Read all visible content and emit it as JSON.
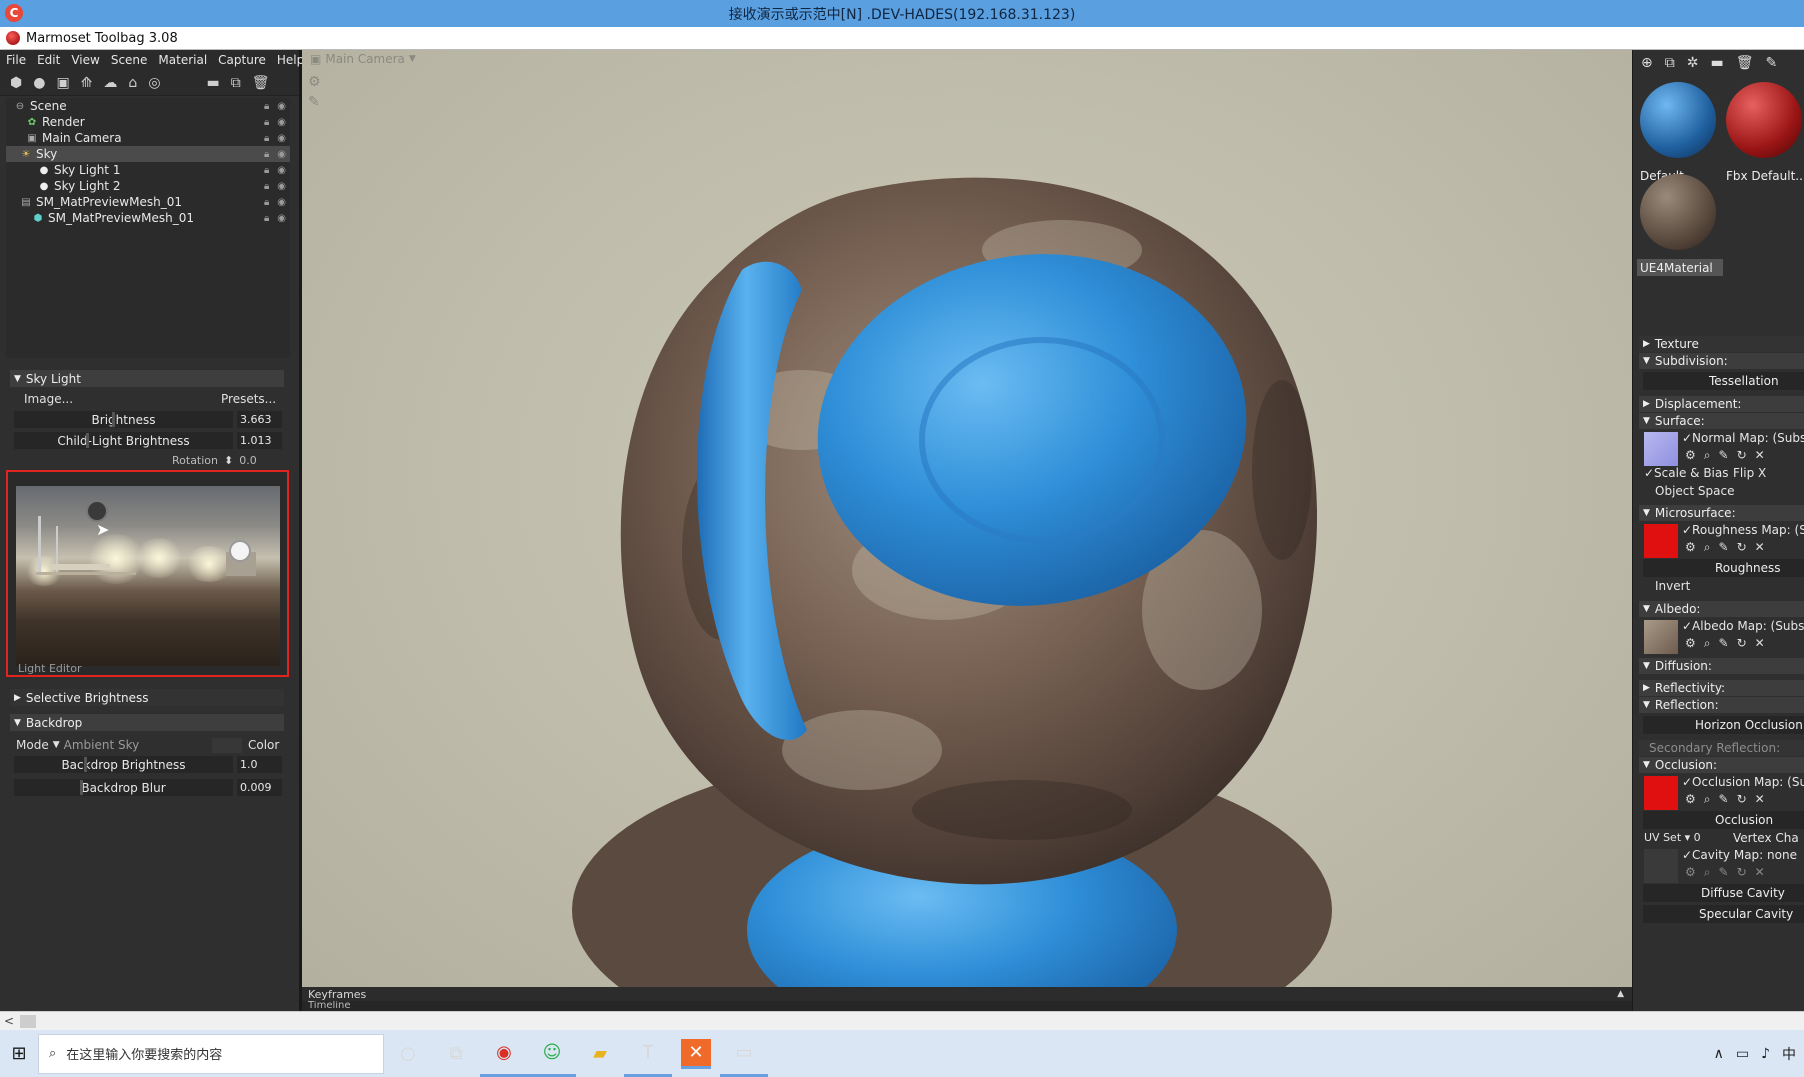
{
  "remote_title": "接收演示或示范中[N] .DEV-HADES(192.168.31.123)",
  "app_title": "Marmoset Toolbag 3.08",
  "menu": [
    "File",
    "Edit",
    "View",
    "Scene",
    "Material",
    "Capture",
    "Help"
  ],
  "scene_tree": [
    {
      "label": "Scene",
      "icon": "scene-icon"
    },
    {
      "label": "Render",
      "icon": "render-icon"
    },
    {
      "label": "Main Camera",
      "icon": "camera-icon"
    },
    {
      "label": "Sky",
      "icon": "sky-icon"
    },
    {
      "label": "Sky Light 1",
      "icon": "light-icon"
    },
    {
      "label": "Sky Light 2",
      "icon": "light-icon"
    },
    {
      "label": "SM_MatPreviewMesh_01",
      "icon": "object-icon"
    },
    {
      "label": "SM_MatPreviewMesh_01",
      "icon": "mesh-icon"
    }
  ],
  "sky_light": {
    "header": "Sky Light",
    "image_button": "Image...",
    "presets_button": "Presets...",
    "brightness_label": "Brightness",
    "brightness_value": "3.663",
    "child_brightness_label": "Child-Light Brightness",
    "child_brightness_value": "1.013",
    "rotation_label": "Rotation",
    "rotation_value": "0.0",
    "light_editor_label": "Light Editor",
    "selective_brightness": "Selective Brightness"
  },
  "backdrop": {
    "header": "Backdrop",
    "mode_label": "Mode",
    "mode_value": "Ambient Sky",
    "color_label": "Color",
    "brightness_label": "Backdrop Brightness",
    "brightness_value": "1.0",
    "blur_label": "Backdrop Blur",
    "blur_value": "0.009"
  },
  "viewport": {
    "camera": "Main Camera"
  },
  "bottom": {
    "keyframes": "Keyframes",
    "timeline": "Timeline"
  },
  "materials": [
    {
      "name": "Default"
    },
    {
      "name": "Fbx Default..."
    },
    {
      "name": "UE4Material"
    }
  ],
  "mat_props": {
    "texture": "Texture",
    "subdivision": "Subdivision:",
    "tessellation": "Tessellation",
    "displacement": "Displacement:",
    "surface": "Surface:",
    "normal_map": "✓Normal Map: (Subst",
    "scale_bias": "✓Scale & Bias",
    "flip_x": "Flip X",
    "object_space": "Object Space",
    "microsurface": "Microsurface:",
    "roughness_map": "✓Roughness Map: (Su",
    "roughness": "Roughness",
    "invert": "Invert",
    "albedo": "Albedo:",
    "albedo_map": "✓Albedo Map: (Substa",
    "diffusion": "Diffusion:",
    "reflectivity": "Reflectivity:",
    "reflection": "Reflection:",
    "horizon_occlusion": "Horizon Occlusion",
    "secondary_reflection": "Secondary Reflection:",
    "occlusion": "Occlusion:",
    "occlusion_map": "✓Occlusion Map: (Sub",
    "occlusion_label": "Occlusion",
    "uv_set": "UV Set ▾ 0",
    "vertex_chan": "Vertex Cha",
    "cavity_map": "✓Cavity Map: none",
    "diffuse_cavity": "Diffuse Cavity",
    "specular_cavity": "Specular Cavity"
  },
  "taskbar": {
    "search_placeholder": "在这里输入你要搜索的内容",
    "ime": "中"
  },
  "colors": {
    "accent_red": "#e0241f",
    "remote_bar": "#5a9fe0",
    "panel": "#2f2f2f",
    "viewport_bg": "#c3c0af",
    "cloth_blue": "#2f8fd8"
  }
}
